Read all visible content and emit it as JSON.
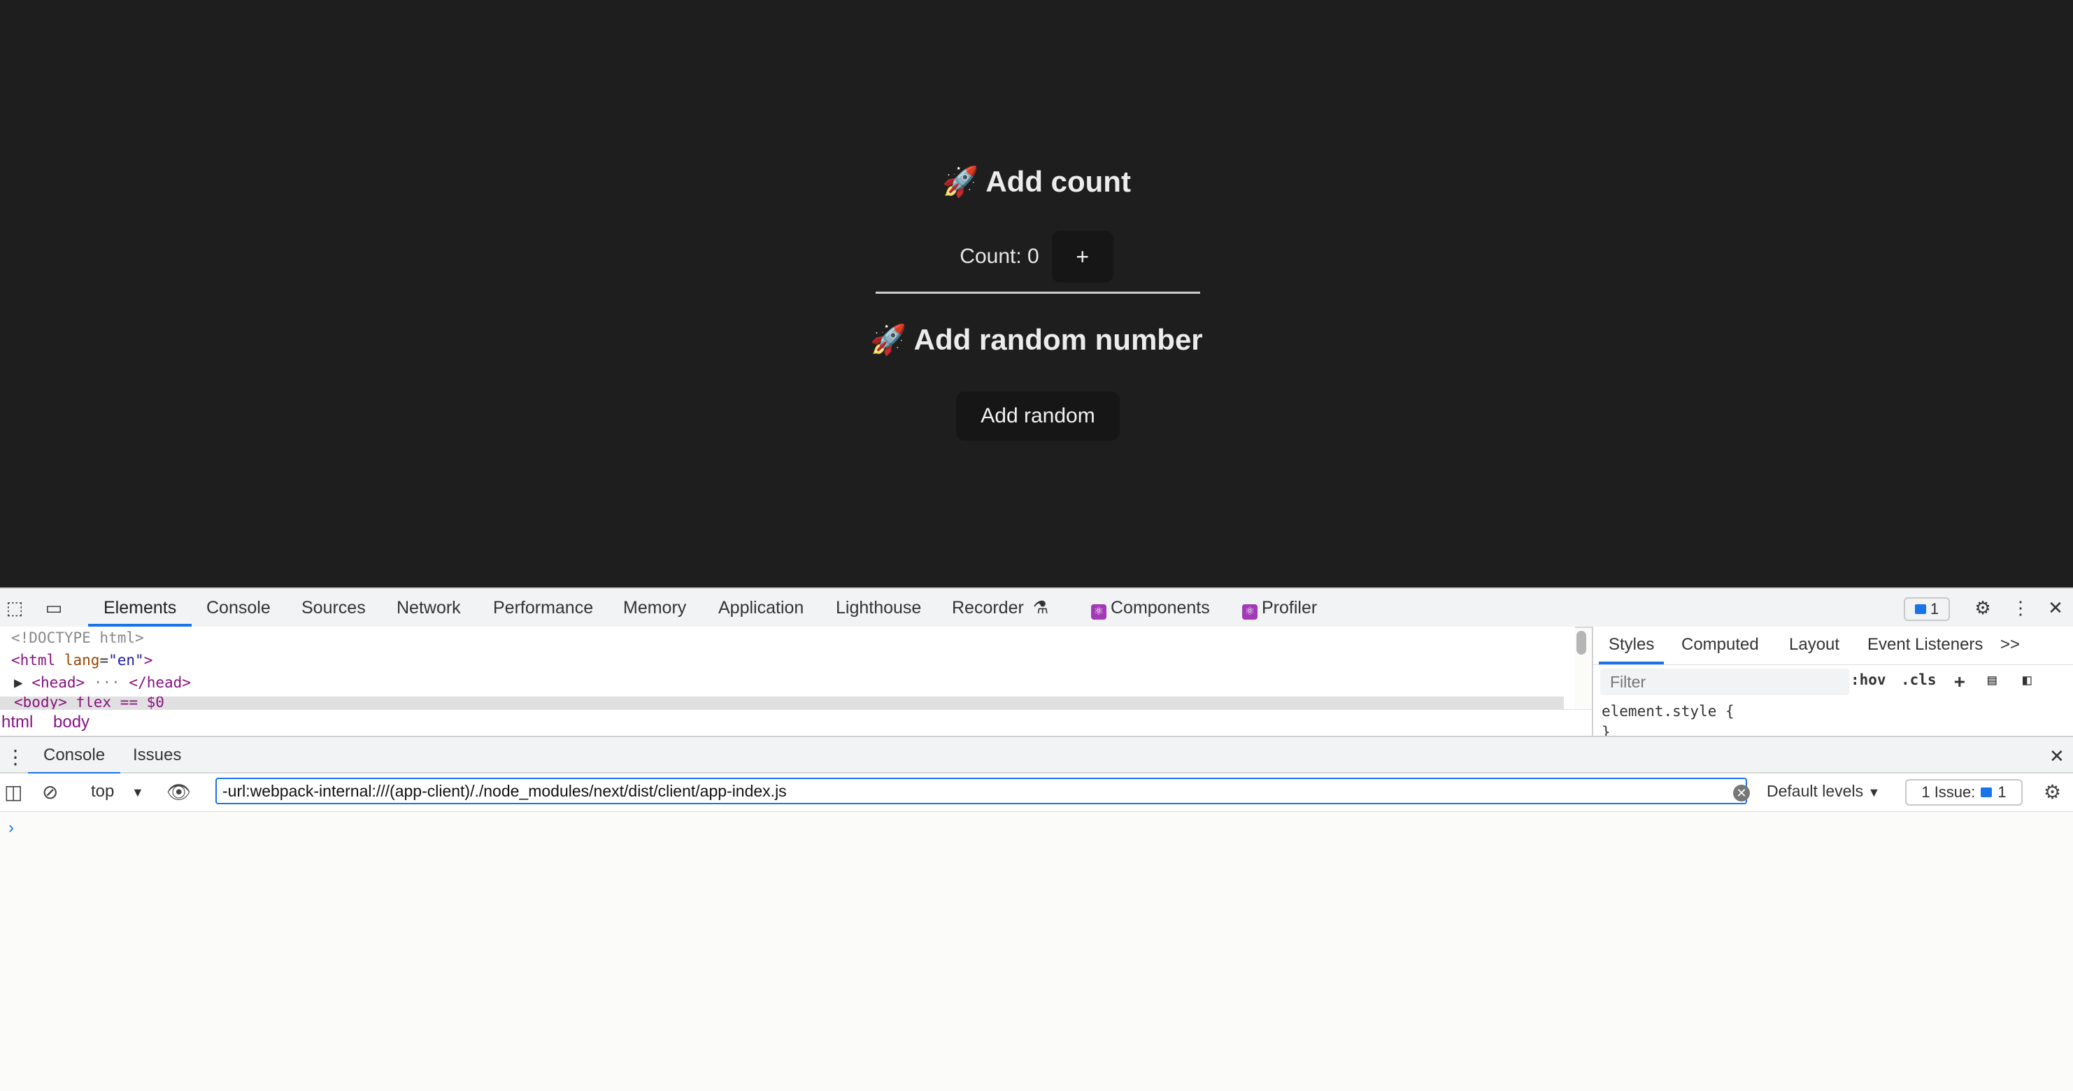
{
  "app": {
    "heading_count": "Add count",
    "count_text": "Count: 0",
    "plus_label": "+",
    "heading_random": "Add random number",
    "random_button": "Add random"
  },
  "devtools": {
    "tabs": [
      "Elements",
      "Console",
      "Sources",
      "Network",
      "Performance",
      "Memory",
      "Application",
      "Lighthouse",
      "Recorder",
      "Components",
      "Profiler"
    ],
    "issue_count": "1",
    "dom": {
      "doctype": "<!DOCTYPE html>",
      "html_tag": "<html",
      "lang_attr": "lang",
      "lang_val": "\"en\"",
      "html_close": ">",
      "head": "<head>",
      "head_close": "</head>",
      "ellipsis": "···",
      "body_line": "<body> flex == $0"
    },
    "breadcrumbs": [
      "html",
      "body"
    ],
    "styles": {
      "tabs": [
        "Styles",
        "Computed",
        "Layout",
        "Event Listeners"
      ],
      "more": ">>",
      "filter_placeholder": "Filter",
      "hov": ":hov",
      "cls": ".cls",
      "element_style_open": "element.style {",
      "element_style_close": "}"
    },
    "drawer": {
      "tabs": [
        "Console",
        "Issues"
      ],
      "context": "top",
      "filter_value": "-url:webpack-internal:///(app-client)/./node_modules/next/dist/client/app-index.js",
      "default_levels": "Default levels",
      "issues_label": "1 Issue:",
      "issues_count": "1",
      "prompt": "›"
    }
  },
  "colors": {
    "accent": "#1a73e8",
    "app_bg": "#1e1e1e",
    "button_bg": "#161616"
  }
}
